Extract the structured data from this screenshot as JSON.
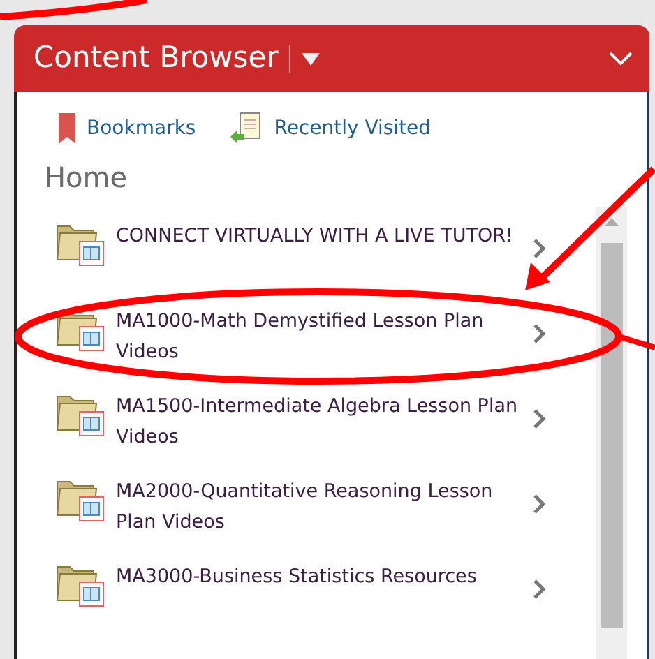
{
  "panel": {
    "title": "Content Browser"
  },
  "links": [
    {
      "label": "Bookmarks",
      "kind": "bookmark"
    },
    {
      "label": "Recently Visited",
      "kind": "recent"
    }
  ],
  "heading": "Home",
  "items": [
    {
      "label": "CONNECT VIRTUALLY WITH A LIVE TUTOR!",
      "circled": false
    },
    {
      "label": "MA1000-Math Demystified Lesson Plan Videos",
      "circled": true
    },
    {
      "label": "MA1500-Intermediate Algebra Lesson Plan Videos",
      "circled": false
    },
    {
      "label": "MA2000-Quantitative Reasoning Lesson Plan Videos",
      "circled": false
    },
    {
      "label": "MA3000-Business Statistics Resources",
      "circled": false
    }
  ]
}
